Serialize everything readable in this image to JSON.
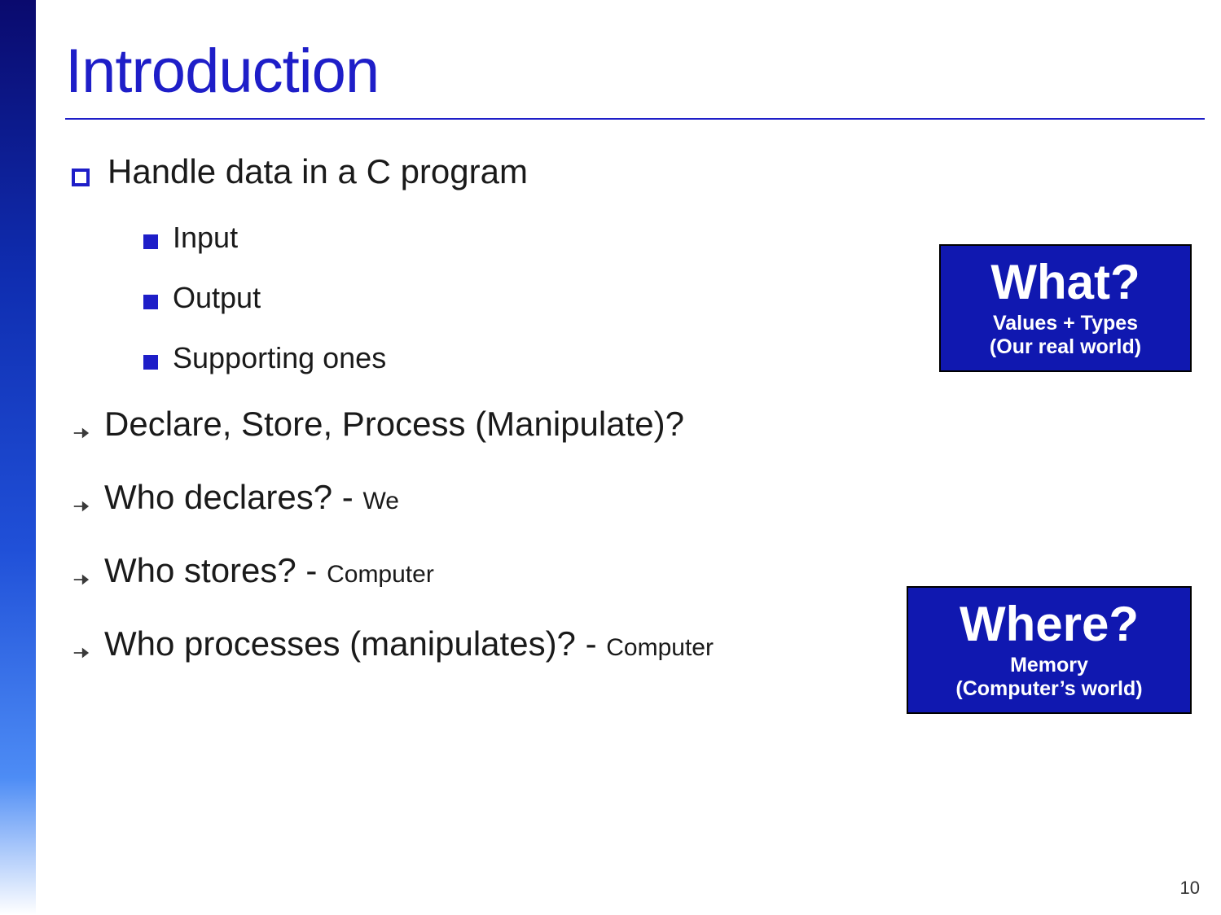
{
  "title": "Introduction",
  "main_bullet": "Handle data in a C program",
  "sub_bullets": [
    "Input",
    "Output",
    "Supporting ones"
  ],
  "arrow_items": [
    {
      "text": "Declare, Store, Process (Manipulate)?",
      "suffix": ""
    },
    {
      "text": "Who declares? - ",
      "suffix": "We"
    },
    {
      "text": "Who stores? - ",
      "suffix": "Computer"
    },
    {
      "text": "Who processes (manipulates)? - ",
      "suffix": "Computer"
    }
  ],
  "callout_what": {
    "big": "What?",
    "line1": "Values + Types",
    "line2": "(Our real world)"
  },
  "callout_where": {
    "big": "Where?",
    "line1": "Memory",
    "line2": "(Computer’s world)"
  },
  "page_number": "10"
}
